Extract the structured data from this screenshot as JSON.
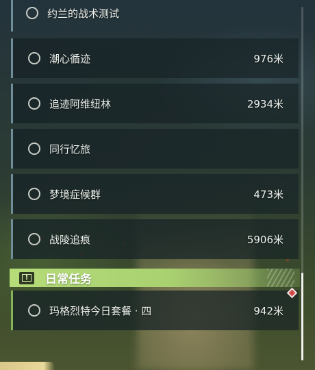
{
  "quest_list": {
    "top_partial": {
      "name": "约兰的战术测试"
    },
    "items": [
      {
        "name": "潮心循迹",
        "distance": "976米"
      },
      {
        "name": "追迹阿维纽林",
        "distance": "2934米"
      },
      {
        "name": "同行忆旅",
        "distance": ""
      },
      {
        "name": "梦境症候群",
        "distance": "473米"
      },
      {
        "name": "战陵追痕",
        "distance": "5906米"
      }
    ]
  },
  "daily_section": {
    "title": "日常任务",
    "badge_glyph": "!",
    "items": [
      {
        "name": "玛格烈特今日套餐 · 四",
        "distance": "942米"
      }
    ]
  },
  "colors": {
    "quest_accent": "#6f8e99",
    "daily_accent": "#86b35a",
    "daily_header": "#b5dc78",
    "tracked_marker": "#d24a4a"
  },
  "icons": {
    "quest_status": "circle-outline-icon",
    "daily_badge": "exclamation-board-icon",
    "tracked_marker": "red-diamond-marker-icon"
  }
}
